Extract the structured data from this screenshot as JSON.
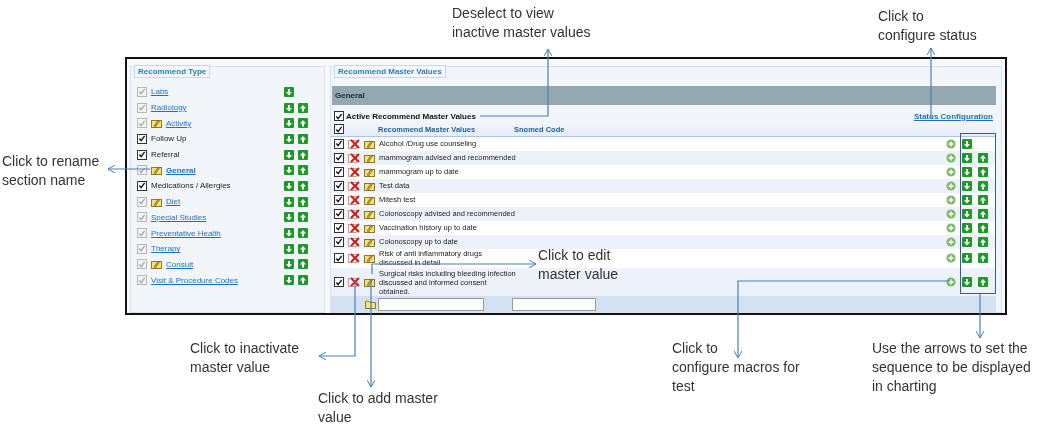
{
  "recommend_type": {
    "legend": "Recommend Type",
    "items": [
      {
        "label": "Labs",
        "checked": true,
        "disabled": true,
        "kind": "link",
        "edit_icon": false,
        "selected": false,
        "move_up": false
      },
      {
        "label": "Radiology",
        "checked": true,
        "disabled": true,
        "kind": "link",
        "edit_icon": false,
        "selected": false,
        "move_up": true
      },
      {
        "label": "Activity",
        "checked": true,
        "disabled": true,
        "kind": "link",
        "edit_icon": true,
        "selected": false,
        "move_up": true
      },
      {
        "label": "Follow Up",
        "checked": true,
        "disabled": false,
        "kind": "text",
        "edit_icon": false,
        "selected": false,
        "move_up": true
      },
      {
        "label": "Referral",
        "checked": true,
        "disabled": false,
        "kind": "text",
        "edit_icon": false,
        "selected": false,
        "move_up": true
      },
      {
        "label": "General",
        "checked": true,
        "disabled": true,
        "kind": "link",
        "edit_icon": true,
        "selected": true,
        "move_up": true
      },
      {
        "label": "Medications / Allergies",
        "checked": true,
        "disabled": false,
        "kind": "text",
        "edit_icon": false,
        "selected": false,
        "move_up": true
      },
      {
        "label": "Diet",
        "checked": true,
        "disabled": true,
        "kind": "link",
        "edit_icon": true,
        "selected": false,
        "move_up": true
      },
      {
        "label": "Special Studies",
        "checked": true,
        "disabled": true,
        "kind": "link",
        "edit_icon": false,
        "selected": false,
        "move_up": true
      },
      {
        "label": "Preventative Health",
        "checked": true,
        "disabled": true,
        "kind": "link",
        "edit_icon": false,
        "selected": false,
        "move_up": true
      },
      {
        "label": "Therapy",
        "checked": true,
        "disabled": true,
        "kind": "link",
        "edit_icon": false,
        "selected": false,
        "move_up": true
      },
      {
        "label": "Consult",
        "checked": true,
        "disabled": true,
        "kind": "link",
        "edit_icon": true,
        "selected": false,
        "move_up": true
      },
      {
        "label": "Visit & Procedure Codes",
        "checked": true,
        "disabled": true,
        "kind": "link",
        "edit_icon": false,
        "selected": false,
        "move_up": true
      }
    ]
  },
  "master_values": {
    "legend": "Recommend Master Values",
    "section_title": "General",
    "active_filter": {
      "label": "Active Recommend Master Values",
      "checked": true
    },
    "status_link": "Status Configuration",
    "header_checked": true,
    "columns": [
      "Recommend Master Values",
      "Snomed Code"
    ],
    "rows": [
      {
        "label": "Alcohol /Drug use counseling",
        "checked": true,
        "move_up": false
      },
      {
        "label": "mammogram advised and recommended",
        "checked": true,
        "move_up": true
      },
      {
        "label": "mammogram up to date",
        "checked": true,
        "move_up": true
      },
      {
        "label": "Test data",
        "checked": true,
        "move_up": true
      },
      {
        "label": "Mitesh test",
        "checked": true,
        "move_up": true
      },
      {
        "label": "Colonoscopy advised and recommended",
        "checked": true,
        "move_up": true
      },
      {
        "label": "Vaccination history up to date",
        "checked": true,
        "move_up": true
      },
      {
        "label": "Colonoscopy up to date",
        "checked": true,
        "move_up": true
      },
      {
        "label": "Risk of anti inflammatory drugs\ndiscussed in detail",
        "checked": true,
        "move_up": true
      },
      {
        "label": "Surgical risks including bleeding infection\ndiscussed and informed consent\nobtained.",
        "checked": true,
        "move_up": true
      }
    ]
  },
  "annotations": [
    {
      "text": "Deselect to view\ninactive master values"
    },
    {
      "text": "Click to\nconfigure status"
    },
    {
      "text": "Click to rename\nsection name"
    },
    {
      "text": "Click to edit\nmaster value"
    },
    {
      "text": "Click to inactivate\nmaster value"
    },
    {
      "text": "Click to add master\nvalue"
    },
    {
      "text": "Click to\nconfigure macros for\ntest"
    },
    {
      "text": "Use the arrows to set the\nsequence to be displayed\nin charting"
    }
  ]
}
